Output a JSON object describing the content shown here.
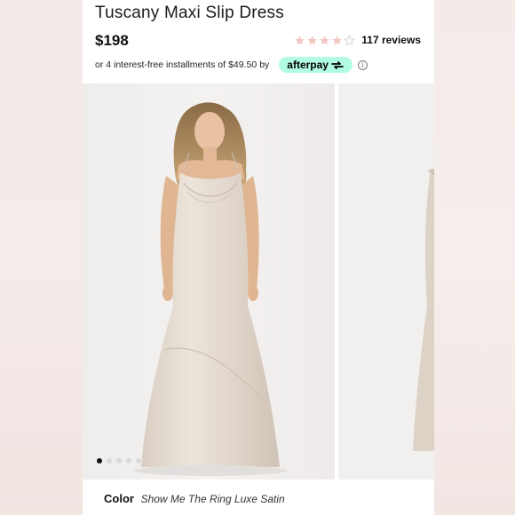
{
  "product": {
    "title": "Tuscany Maxi Slip Dress",
    "price": "$198",
    "rating": {
      "stars_filled": 4,
      "stars_total": 5,
      "reviews": "117 reviews"
    },
    "installments": {
      "text": "or 4 interest-free installments of",
      "amount": "$49.50",
      "by": "by",
      "provider": "afterpay"
    },
    "color": {
      "label": "Color",
      "value": "Show Me The Ring Luxe Satin"
    }
  },
  "gallery": {
    "slides_total": 5,
    "active_index": 0
  },
  "colors": {
    "afterpay_bg": "#b2fce4",
    "star_fill": "#f2c7c3",
    "star_empty": "#e8e8e8",
    "dress": "#e6ddd3",
    "background_pink": "#f3e9e7"
  },
  "icons": {
    "star": "star-icon",
    "info": "info-icon",
    "afterpay_logo": "afterpay-arrows-icon"
  }
}
